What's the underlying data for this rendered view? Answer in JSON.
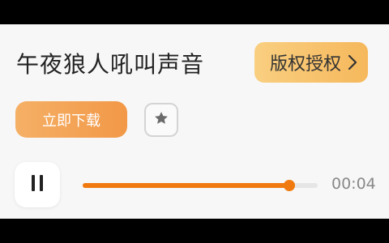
{
  "sound": {
    "title": "午夜狼人吼叫声音"
  },
  "actions": {
    "license_label": "版权授权",
    "download_label": "立即下载",
    "favorite_icon": "star-icon"
  },
  "player": {
    "pause_icon": "pause-icon",
    "current_time": "00:04",
    "progress_fraction": 0.88
  },
  "colors": {
    "accent": "#f07a10",
    "license_gradient_start": "#f9cf80",
    "license_gradient_end": "#f6b85c",
    "download_gradient_start": "#f5b066",
    "download_gradient_end": "#f29847"
  }
}
